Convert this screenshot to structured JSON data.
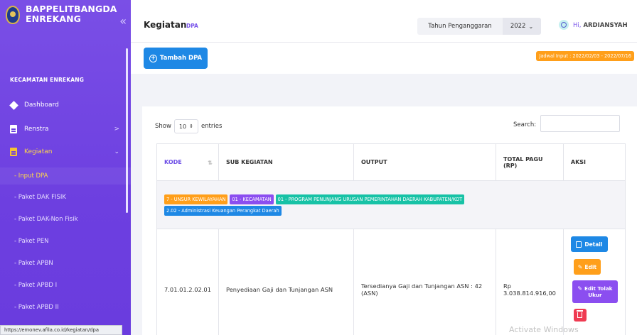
{
  "sidebar": {
    "brand_line1": "BAPPELITBANGDA",
    "brand_line2": "ENREKANG",
    "collapse_glyph": "«",
    "section_title": "KECAMATAN ENREKANG",
    "items": [
      {
        "label": "Dashboard",
        "icon": "diamond-icon"
      },
      {
        "label": "Renstra",
        "icon": "document-icon"
      },
      {
        "label": "Kegiatan",
        "icon": "document-icon"
      }
    ],
    "sub_items": [
      {
        "label": "- Input DPA"
      },
      {
        "label": "- Paket DAK FISIK"
      },
      {
        "label": "- Paket DAK-Non Fisik"
      },
      {
        "label": "- Paket PEN"
      },
      {
        "label": "- Paket APBN"
      },
      {
        "label": "- Paket APBD I"
      },
      {
        "label": "- Paket APBD II"
      }
    ]
  },
  "header": {
    "title": "Kegiatan",
    "subtitle": "DPA",
    "year_label": "Tahun Penganggaran",
    "year_value": "2022",
    "greeting": "Hi,",
    "user_name": "ARDIANSYAH"
  },
  "toolbar": {
    "add_label": "Tambah DPA",
    "schedule": "Jadwal Input : 2022/02/03 - 2022/07/16"
  },
  "table_controls": {
    "show_label": "Show",
    "entries_value": "10",
    "entries_label": "entries",
    "search_label": "Search:"
  },
  "table": {
    "columns": [
      "KODE",
      "SUB KEGIATAN",
      "OUTPUT",
      "TOTAL PAGU (RP)",
      "AKSI"
    ],
    "group_tags": [
      {
        "text": "7 - UNSUR KEWILAYAHAN",
        "color": "#ff9f1a"
      },
      {
        "text": "01 - KECAMATAN",
        "color": "#8b4ef0"
      },
      {
        "text": "01 - PROGRAM PENUNJANG URUSAN PEMERINTAHAN DAERAH KABUPATEN/KOT",
        "color": "#17c2a6"
      },
      {
        "text": "2.02 - Administrasi Keuangan Perangkat Daerah",
        "color": "#1e88e5"
      }
    ],
    "rows": [
      {
        "kode": "7.01.01.2.02.01",
        "sub_kegiatan": "Penyediaan Gaji dan Tunjangan ASN",
        "output": "Tersedianya Gaji dan Tunjangan ASN : 42 (ASN)",
        "total_pagu_line1": "Rp",
        "total_pagu_line2": "3.038.814.916,00"
      }
    ],
    "actions": {
      "detail": "Detail",
      "edit": "Edit",
      "edit_tolak_line1": "Edit Tolak",
      "edit_tolak_line2": "Ukur"
    }
  },
  "status_bar_url": "https://emonev.afila.co.id/kegiatan/dpa",
  "watermark": "Activate Windows"
}
